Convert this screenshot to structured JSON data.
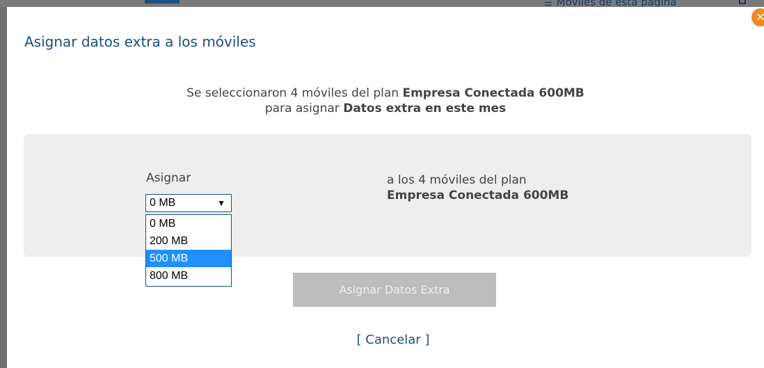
{
  "background": {
    "mobiles_link": "Móviles de esta página"
  },
  "modal": {
    "title": "Asignar datos extra a los móviles",
    "summary_line1_prefix": "Se seleccionaron 4 móviles del plan ",
    "summary_line1_plan": "Empresa Conectada 600MB",
    "summary_line2_prefix": "para asignar ",
    "summary_line2_bold": "Datos extra en este mes",
    "assign_label": "Asignar",
    "select": {
      "value": "0 MB",
      "options": [
        "0 MB",
        "200 MB",
        "500 MB",
        "800 MB"
      ],
      "highlighted": "500 MB"
    },
    "plan_line1": "a los 4 móviles del plan",
    "plan_line2": "Empresa Conectada 600MB",
    "submit_label": "Asignar Datos Extra",
    "cancel_label": "[ Cancelar ]"
  },
  "colors": {
    "title_blue": "#1a4f82",
    "highlight_blue": "#1e90ff",
    "close_orange": "#f08a24",
    "disabled_button": "#bdbdbd"
  }
}
